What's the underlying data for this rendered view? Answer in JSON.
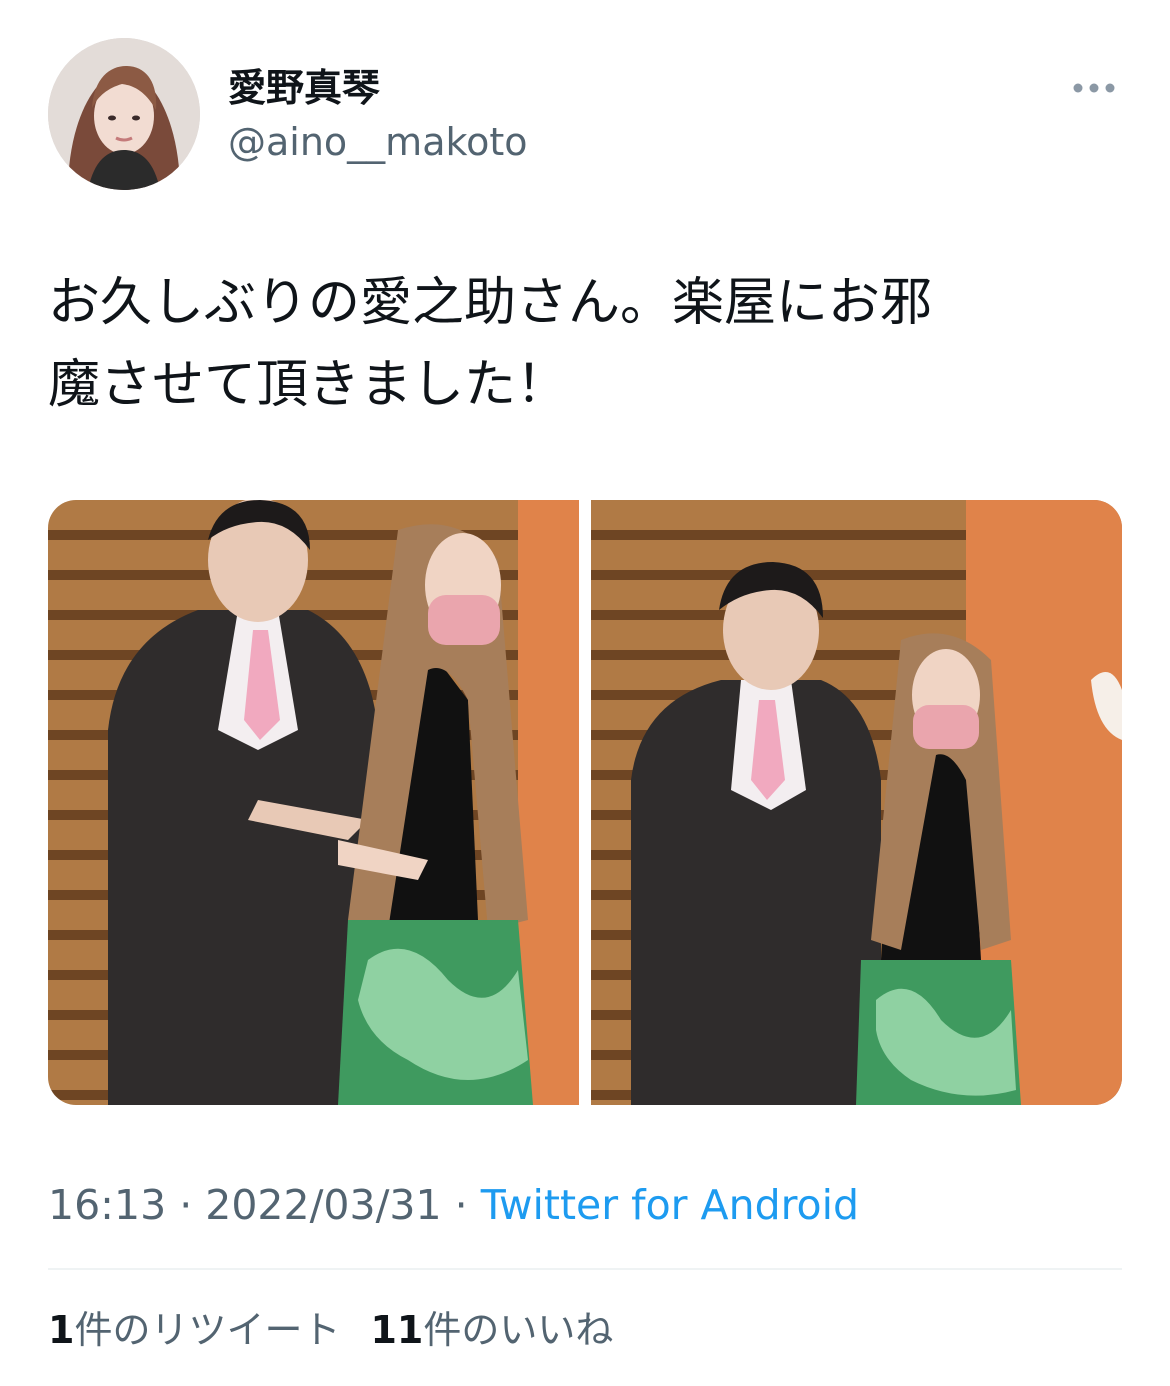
{
  "author": {
    "display_name": "愛野真琴",
    "handle": "@aino__makoto",
    "avatar_icon": "profile-photo"
  },
  "more_icon": "more-horizontal-icon",
  "tweet": {
    "line1": "お久しぶりの愛之助さん。楽屋にお邪",
    "line2": "魔させて頂きました！"
  },
  "media": [
    {
      "description": "photo"
    },
    {
      "description": "photo"
    }
  ],
  "meta": {
    "time": "16:13",
    "separator": " · ",
    "date": "2022/03/31",
    "source": "Twitter for Android"
  },
  "stats": {
    "retweet_count": "1",
    "retweet_label": "件のリツイート",
    "like_count": "11",
    "like_label": "件のいいね"
  },
  "colors": {
    "text": "#0f1419",
    "secondary": "#536471",
    "link": "#1d9bf0"
  }
}
